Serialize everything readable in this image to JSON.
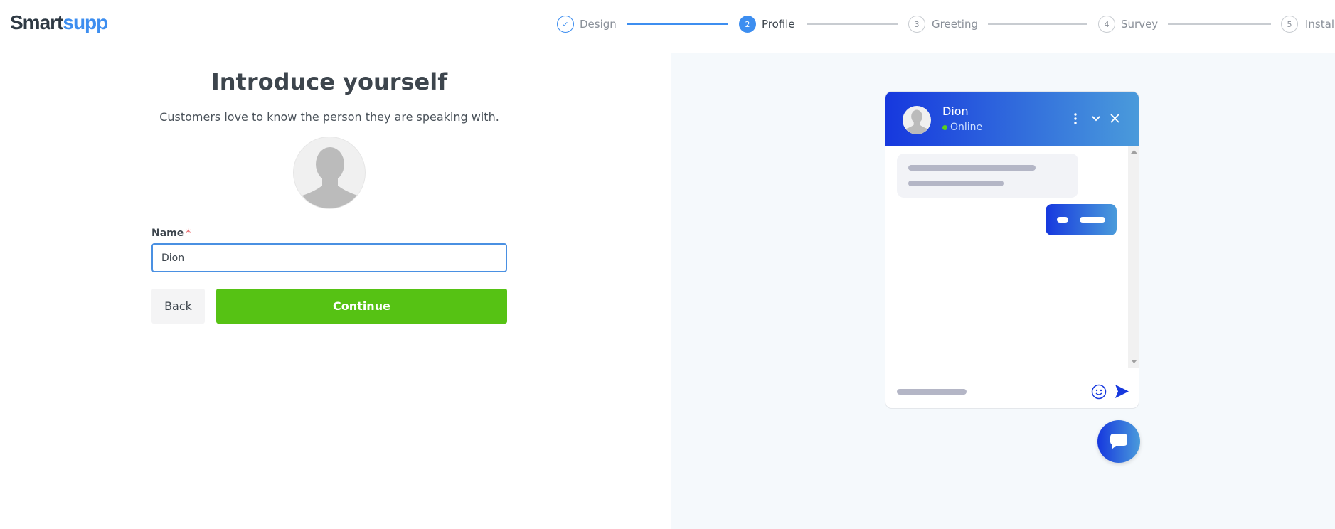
{
  "brand": {
    "logo_part1": "Smart",
    "logo_part2": "supp",
    "primary_color": "#3d8ef0",
    "accent_green": "#56c214"
  },
  "stepper": {
    "steps": [
      {
        "number": "✓",
        "label": "Design",
        "state": "done"
      },
      {
        "number": "2",
        "label": "Profile",
        "state": "active"
      },
      {
        "number": "3",
        "label": "Greeting",
        "state": "todo"
      },
      {
        "number": "4",
        "label": "Survey",
        "state": "todo"
      },
      {
        "number": "5",
        "label": "Install",
        "state": "todo"
      }
    ]
  },
  "form": {
    "title": "Introduce yourself",
    "subtitle": "Customers love to know the person they are speaking with.",
    "name_label": "Name",
    "required_mark": "*",
    "name_value": "Dion",
    "back_label": "Back",
    "continue_label": "Continue"
  },
  "preview": {
    "agent_name": "Dion",
    "status": "Online",
    "icons": [
      "more-vertical-icon",
      "chevron-down-icon",
      "close-icon",
      "emoji-icon",
      "send-icon",
      "chat-bubble-icon"
    ]
  }
}
